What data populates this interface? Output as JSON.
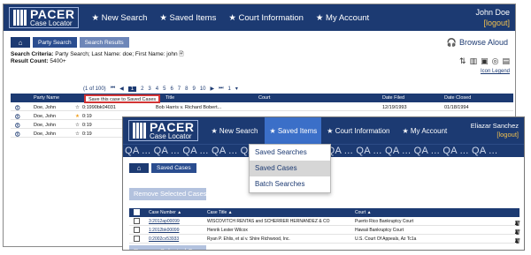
{
  "back": {
    "logo": {
      "line1": "PACER",
      "line2": "Case Locator"
    },
    "nav": [
      "★ New Search",
      "★ Saved Items",
      "★ Court Information",
      "★ My Account"
    ],
    "user": {
      "name": "John Doe",
      "logout": "[logout]"
    },
    "breadcrumb": {
      "home_icon": "home-icon",
      "items": [
        "Party Search",
        "Search Results"
      ]
    },
    "browse_aloud": "Browse Aloud",
    "criteria_label": "Search Criteria:",
    "criteria_value": "Party Search; Last Name: doe; First Name: john",
    "count_label": "Result Count:",
    "count_value": "5400+",
    "icon_legend": "Icon Legend",
    "pager": {
      "info": "(1 of 100)",
      "pages": [
        "1",
        "2",
        "3",
        "4",
        "5",
        "6",
        "7",
        "8",
        "9",
        "10"
      ],
      "current": "1"
    },
    "tooltip": "Save this case to Saved Cases",
    "columns": [
      "Party Name",
      "C",
      "Title",
      "Court",
      "Date Filed",
      "Date Closed"
    ],
    "rows": [
      {
        "name": "Doe, John",
        "case": "0:1990bk04031",
        "title": "Bob Harris v. Richard Bobert...",
        "filed": "12/19/1993",
        "closed": "01/18/1994"
      },
      {
        "name": "Doe, John",
        "case": "0:19",
        "title": "",
        "filed": "",
        "closed": ""
      },
      {
        "name": "Doe, John",
        "case": "0:19",
        "title": "",
        "filed": "",
        "closed": ""
      },
      {
        "name": "Doe, John",
        "case": "0:19",
        "title": "",
        "filed": "",
        "closed": ""
      }
    ]
  },
  "front": {
    "logo": {
      "line1": "PACER",
      "line2": "Case Locator"
    },
    "nav": [
      "★ New Search",
      "★ Saved Items",
      "★ Court Information",
      "★ My Account"
    ],
    "user": {
      "name": "Eliazar Sanchez",
      "logout": "[logout]"
    },
    "qa_banner": "QA ... QA ... QA ... QA ... QA ... QA ... QA ... QA ... QA ... QA ... QA ... QA ... QA ...",
    "dropdown": [
      "Saved Searches",
      "Saved Cases",
      "Batch Searches"
    ],
    "breadcrumb": {
      "home_icon": "home-icon",
      "item": "Saved Cases"
    },
    "remove_button": "Remove Selected Cases",
    "columns": {
      "case_number": "Case Number ▲",
      "case_title": "Case Title ▲",
      "court": "Court ▲"
    },
    "rows": [
      {
        "case": "3:2012ap00099",
        "title": "WISCOVITCH RENTAS and SCHERRER HERNANDEZ & CO",
        "court": "Puerto Rico Bankruptcy Court"
      },
      {
        "case": "1:2012bk00099",
        "title": "Henrik Lester Wilcox",
        "court": "Hawaii Bankruptcy Court"
      },
      {
        "case": "0:2002cv53933",
        "title": "Ryan P. Ehlis, et al v. Shire Richwood, Inc.",
        "court": "U.S. Court Of Appeals, Az Tc1a"
      }
    ]
  }
}
